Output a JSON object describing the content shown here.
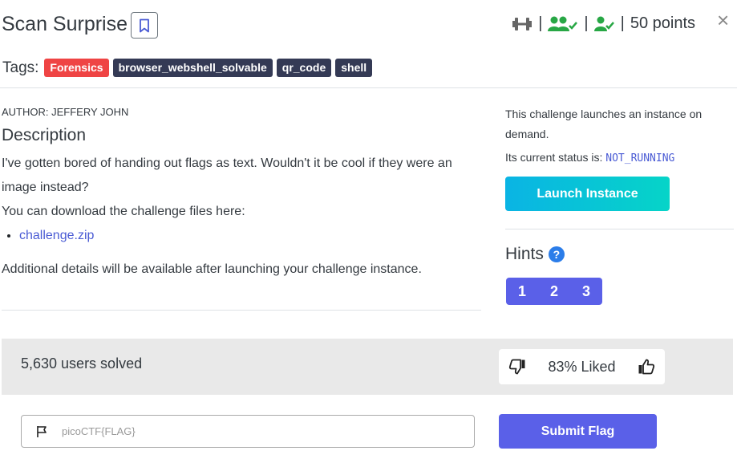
{
  "header": {
    "title": "Scan Surprise",
    "points": "50 points",
    "separator": "|",
    "close_glyph": "×",
    "icons": [
      "dumbbell-icon",
      "users-check-icon",
      "user-check-icon",
      "bookmark-icon",
      "close-icon"
    ]
  },
  "tags": {
    "label": "Tags:",
    "items": [
      {
        "text": "Forensics",
        "color": "#ef4444"
      },
      {
        "text": "browser_webshell_solvable",
        "color": "#343a55"
      },
      {
        "text": "qr_code",
        "color": "#343a55"
      },
      {
        "text": "shell",
        "color": "#343a55"
      }
    ]
  },
  "challenge": {
    "author": "AUTHOR: JEFFERY JOHN",
    "description_heading": "Description",
    "description": "I've gotten bored of handing out flags as text. Wouldn't it be cool if they were an image instead?",
    "download_text": "You can download the challenge files here:",
    "file_link": "challenge.zip",
    "additional": "Additional details will be available after launching your challenge instance."
  },
  "instance": {
    "info": "This challenge launches an instance on demand.",
    "status_label": "Its current status is:",
    "status_value": "NOT_RUNNING",
    "launch_label": "Launch Instance"
  },
  "hints": {
    "title": "Hints",
    "help_glyph": "?",
    "items": [
      "1",
      "2",
      "3"
    ]
  },
  "stats": {
    "solved": "5,630 users solved",
    "liked": "83% Liked"
  },
  "flag": {
    "placeholder": "picoCTF{FLAG}",
    "value": "",
    "submit_label": "Submit Flag"
  },
  "colors": {
    "accent": "#5a60e8",
    "success": "#28a745",
    "danger": "#ef4444",
    "link": "#4a5bd4"
  }
}
